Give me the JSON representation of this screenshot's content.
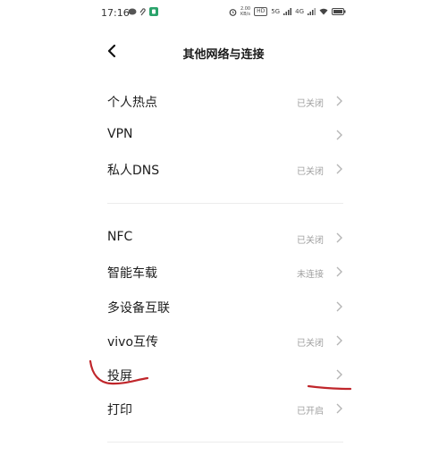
{
  "status_bar": {
    "time": "17:16",
    "net_speed_value": "2.00",
    "net_speed_unit": "KB/s",
    "hd_label": "HD",
    "signal_1": "5G",
    "signal_2": "4G"
  },
  "nav": {
    "title": "其他网络与连接"
  },
  "group1": [
    {
      "label": "个人热点",
      "value": "已关闭"
    },
    {
      "label": "VPN",
      "value": ""
    },
    {
      "label": "私人DNS",
      "value": "已关闭"
    }
  ],
  "group2": [
    {
      "label": "NFC",
      "value": "已关闭"
    },
    {
      "label": "智能车载",
      "value": "未连接"
    },
    {
      "label": "多设备互联",
      "value": ""
    },
    {
      "label": "vivo互传",
      "value": "已关闭"
    },
    {
      "label": "投屏",
      "value": ""
    },
    {
      "label": "打印",
      "value": "已开启"
    }
  ],
  "colors": {
    "annotation_ink": "#c0262b",
    "accent": "#1a1a1a"
  }
}
